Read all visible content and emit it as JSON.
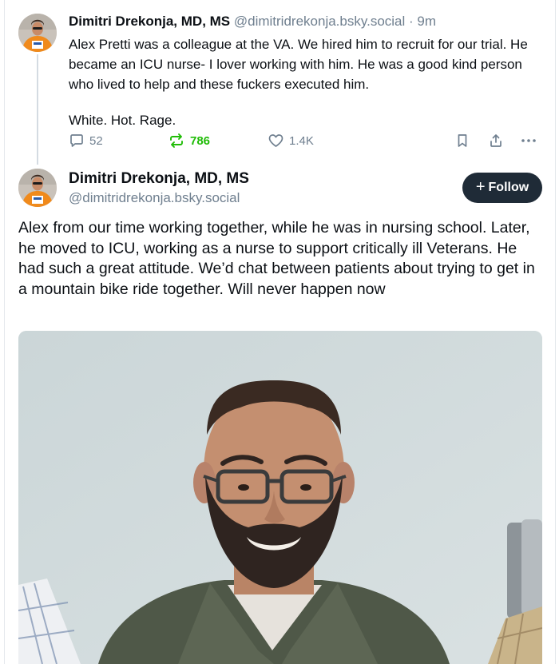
{
  "parent_post": {
    "author_name": "Dimitri Drekonja, MD, MS",
    "handle": "@dimitridrekonja.bsky.social",
    "separator": "·",
    "time": "9m",
    "text_paragraph_1": "Alex Pretti was a colleague at the VA. We hired him to recruit for our trial. He became an ICU nurse- I lover working with him. He was a good kind person who lived to help and these fuckers executed him.",
    "text_paragraph_2": "White. Hot. Rage.",
    "reply_count": "52",
    "repost_count": "786",
    "like_count": "1.4K",
    "reposted": true
  },
  "main_post": {
    "author_name": "Dimitri Drekonja, MD, MS",
    "handle": "@dimitridrekonja.bsky.social",
    "follow_label": "Follow",
    "follow_plus": "+",
    "text": "Alex from our time working together, while he was in nursing school. Later, he moved to ICU, working as a nurse to support critically ill Veterans. He had such a great attitude. We’d chat between patients about trying to get in a mountain bike ride together. Will never happen now"
  },
  "icons": {
    "reply": "speech-bubble-icon",
    "repost": "repost-arrows-icon",
    "like": "heart-icon",
    "bookmark": "bookmark-icon",
    "share": "share-icon",
    "more": "ellipsis-icon"
  },
  "colors": {
    "text": "#0b0f14",
    "muted": "#6f7f8f",
    "repost_active": "#20bc07",
    "follow_bg": "#1f2b37",
    "thread_line": "#d4dbe2"
  }
}
